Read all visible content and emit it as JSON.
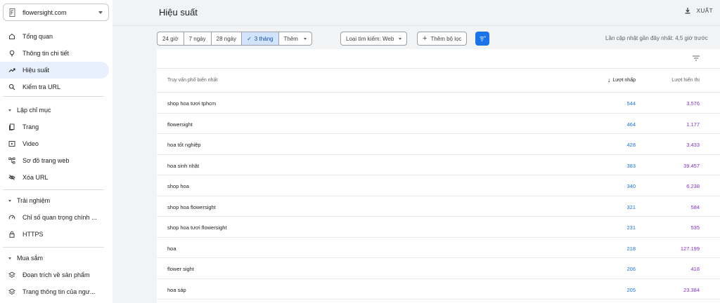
{
  "property": {
    "name": "flowersight.com"
  },
  "sidebar": {
    "items": [
      {
        "label": "Tổng quan",
        "icon": "home-icon"
      },
      {
        "label": "Thông tin chi tiết",
        "icon": "lightbulb-icon"
      },
      {
        "label": "Hiệu suất",
        "icon": "trending-up-icon",
        "active": true
      },
      {
        "label": "Kiểm tra URL",
        "icon": "search-icon"
      }
    ],
    "sections": [
      {
        "title": "Lập chỉ mục",
        "items": [
          {
            "label": "Trang",
            "icon": "pages-icon"
          },
          {
            "label": "Video",
            "icon": "video-icon"
          },
          {
            "label": "Sơ đồ trang web",
            "icon": "sitemap-icon"
          },
          {
            "label": "Xóa URL",
            "icon": "eye-off-icon"
          }
        ]
      },
      {
        "title": "Trải nghiệm",
        "items": [
          {
            "label": "Chỉ số quan trọng chính ...",
            "icon": "gauge-icon"
          },
          {
            "label": "HTTPS",
            "icon": "lock-icon"
          }
        ]
      },
      {
        "title": "Mua sắm",
        "items": [
          {
            "label": "Đoạn trích về sản phẩm",
            "icon": "layers-icon"
          },
          {
            "label": "Trang thông tin của ngư...",
            "icon": "layers-icon"
          }
        ]
      }
    ]
  },
  "header": {
    "title": "Hiệu suất",
    "export_label": "XUẤT"
  },
  "toolbar": {
    "date_ranges": [
      "24 giờ",
      "7 ngày",
      "28 ngày",
      "3 tháng"
    ],
    "selected_range": "3 tháng",
    "more_label": "Thêm",
    "search_type": "Loại tìm kiếm: Web",
    "add_filter": "Thêm bộ lọc",
    "last_updated": "Lần cập nhật gần đây nhất: 4,5 giờ trước"
  },
  "table": {
    "columns": {
      "query": "Truy vấn phổ biến nhất",
      "clicks": "Lượt nhấp",
      "impressions": "Lượt hiển thị"
    },
    "rows": [
      {
        "query": "shop hoa tươi tphcm",
        "clicks": "544",
        "impressions": "3.576"
      },
      {
        "query": "flowersight",
        "clicks": "464",
        "impressions": "1.177"
      },
      {
        "query": "hoa tốt nghiệp",
        "clicks": "428",
        "impressions": "3.433"
      },
      {
        "query": "hoa sinh nhật",
        "clicks": "383",
        "impressions": "39.457"
      },
      {
        "query": "shop hoa",
        "clicks": "340",
        "impressions": "6.238"
      },
      {
        "query": "shop hoa flowersight",
        "clicks": "321",
        "impressions": "584"
      },
      {
        "query": "shop hoa tươi flowersight",
        "clicks": "231",
        "impressions": "535"
      },
      {
        "query": "hoa",
        "clicks": "218",
        "impressions": "127.199"
      },
      {
        "query": "flower sight",
        "clicks": "206",
        "impressions": "418"
      },
      {
        "query": "hoa sáp",
        "clicks": "205",
        "impressions": "23.384"
      }
    ]
  },
  "colors": {
    "clicks": "#1a73e8",
    "impressions": "#8430ce",
    "active_nav": "#e8f0fe",
    "primary": "#1a73e8"
  }
}
